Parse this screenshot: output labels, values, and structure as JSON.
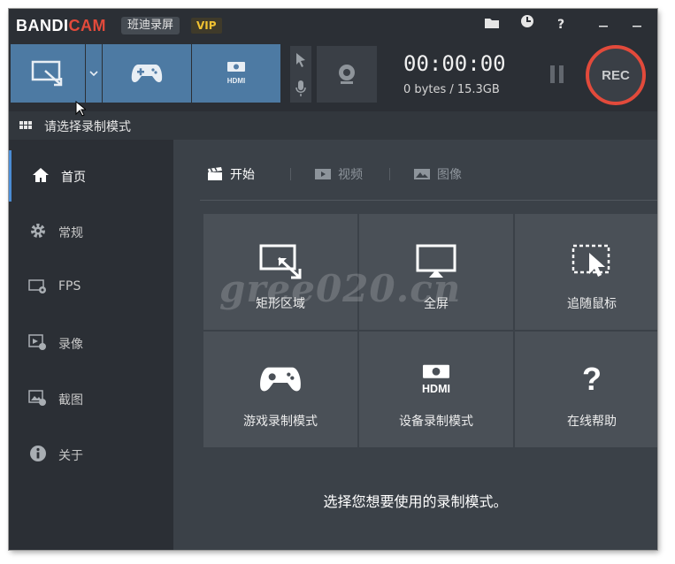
{
  "app": {
    "brand_left": "BANDI",
    "brand_right": "CAM",
    "cn_name": "班迪录屏",
    "vip": "VIP",
    "titlebar_icons": [
      "folder-icon",
      "clock-icon",
      "help-icon",
      "minimize-icon",
      "close-icon"
    ],
    "help_glyph": "?"
  },
  "toolbar": {
    "modes": [
      "rectangle-area-icon",
      "dropdown-chevron-icon",
      "gamepad-icon",
      "hdmi-icon"
    ],
    "hdmi_text": "HDMI",
    "timer": "00:00:00",
    "size": "0 bytes / 15.3GB",
    "rec": "REC"
  },
  "mode_title": "请选择录制模式",
  "sidebar": {
    "items": [
      {
        "label": "首页",
        "icon": "home-icon",
        "active": true
      },
      {
        "label": "常规",
        "icon": "gear-icon",
        "active": false
      },
      {
        "label": "FPS",
        "icon": "fps-icon",
        "active": false
      },
      {
        "label": "录像",
        "icon": "video-settings-icon",
        "active": false
      },
      {
        "label": "截图",
        "icon": "image-settings-icon",
        "active": false
      },
      {
        "label": "关于",
        "icon": "info-icon",
        "active": false
      }
    ]
  },
  "tabs": [
    {
      "label": "开始",
      "icon": "clapper-icon",
      "active": true
    },
    {
      "label": "视频",
      "icon": "video-icon",
      "active": false
    },
    {
      "label": "图像",
      "icon": "image-icon",
      "active": false
    }
  ],
  "tiles": [
    {
      "label": "矩形区域",
      "icon": "rectangle-area-icon"
    },
    {
      "label": "全屏",
      "icon": "fullscreen-icon"
    },
    {
      "label": "追随鼠标",
      "icon": "follow-mouse-icon"
    },
    {
      "label": "游戏录制模式",
      "icon": "gamepad-icon"
    },
    {
      "label": "设备录制模式",
      "icon": "hdmi-icon"
    },
    {
      "label": "在线帮助",
      "icon": "question-icon"
    }
  ],
  "help_glyph": "?",
  "hint": "选择您想要使用的录制模式。",
  "watermark": "gree020.cn",
  "colors": {
    "accent_blue": "#4d7aa3",
    "rec_red": "#e24a3b",
    "vip_yellow": "#f1c232"
  }
}
